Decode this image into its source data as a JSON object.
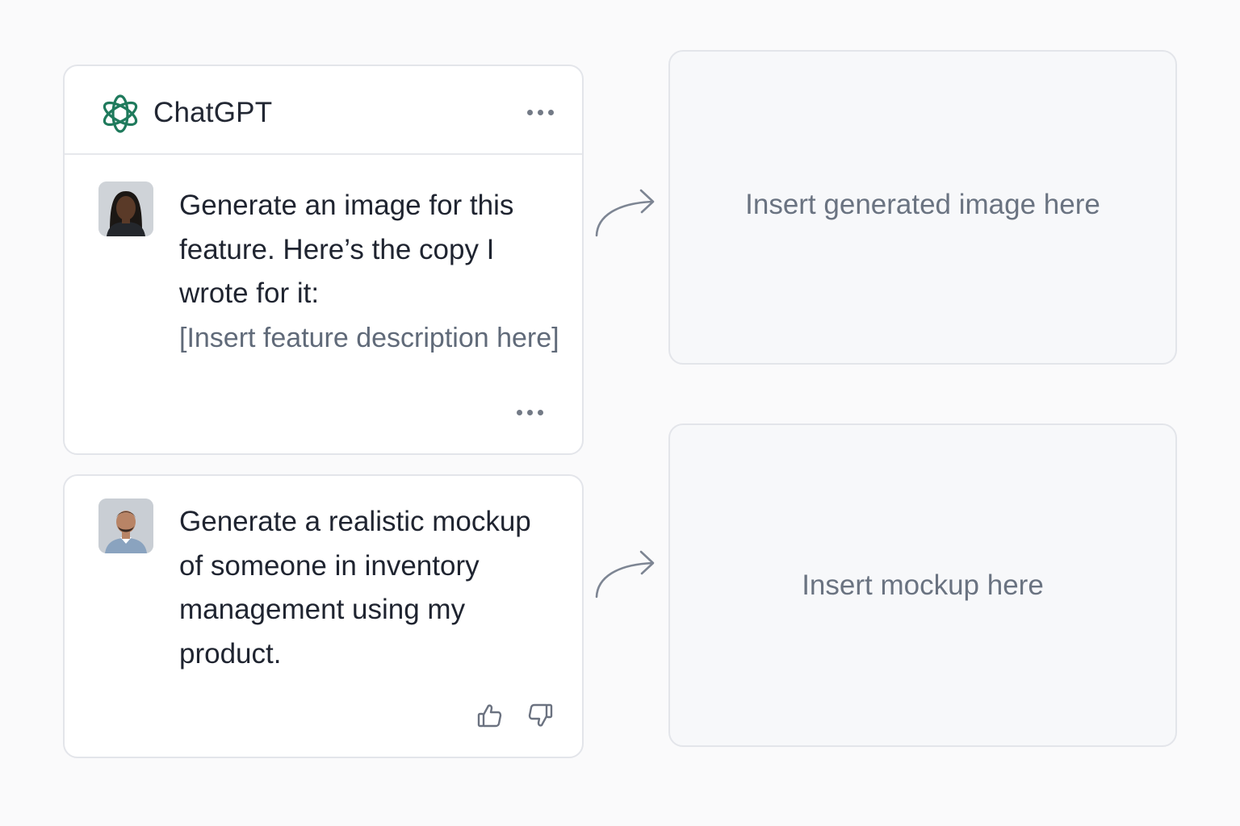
{
  "app": {
    "title": "ChatGPT",
    "logo_icon": "openai-logo-icon",
    "brand_color": "#1f7a5c"
  },
  "messages": [
    {
      "avatar_icon": "user-avatar-woman",
      "lines": [
        "Generate an image for this",
        "feature. Here’s the copy I",
        "wrote for it:"
      ],
      "placeholder": "[Insert feature description here]",
      "action_icon": "more-options-icon"
    },
    {
      "avatar_icon": "user-avatar-man",
      "lines": [
        "Generate a realistic mockup",
        "of someone in inventory",
        "management using my",
        "product."
      ],
      "action_icons": [
        "thumbs-up-icon",
        "thumbs-down-icon"
      ]
    }
  ],
  "outputs": {
    "generated_image_placeholder": "Insert generated image here",
    "mockup_placeholder": "Insert mockup here"
  },
  "colors": {
    "background": "#fafafb",
    "card_border": "#e3e5ea",
    "text": "#1f2430",
    "muted_text": "#6a7381",
    "arrow": "#7d8593"
  }
}
